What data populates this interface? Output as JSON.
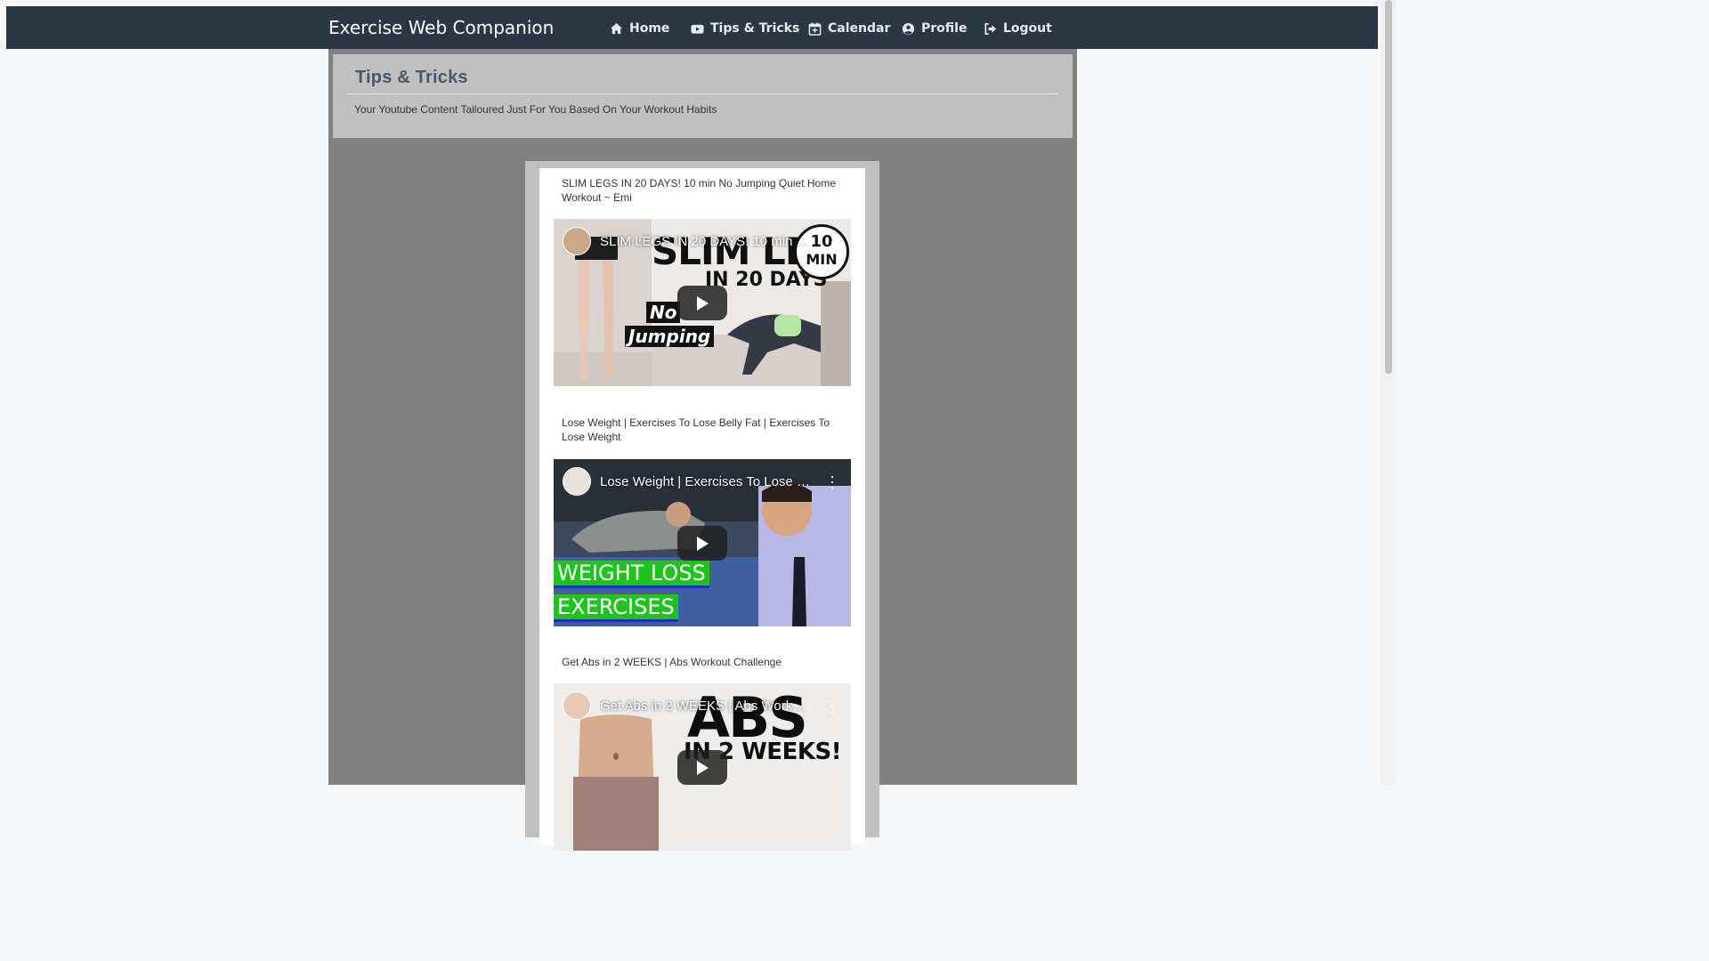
{
  "nav": {
    "brand": "Exercise Web Companion",
    "items": [
      {
        "label": "Home",
        "icon": "home-icon"
      },
      {
        "label": "Tips & Tricks",
        "icon": "youtube-icon"
      },
      {
        "label": "Calendar",
        "icon": "calendar-icon"
      },
      {
        "label": "Profile",
        "icon": "user-circle-icon"
      },
      {
        "label": "Logout",
        "icon": "sign-out-icon"
      }
    ]
  },
  "page": {
    "title": "Tips & Tricks",
    "subtitle": "Your Youtube Content Tailoured Just For You Based On Your Workout Habits"
  },
  "videos": [
    {
      "title": "SLIM LEGS IN 20 DAYS! 10 min No Jumping Quiet Home Workout ~ Emi",
      "player_title": "SLIM LEGS IN 20 DAYS! 10 min N...",
      "thumb_text": [
        "SLIM LEG",
        "IN 20 DAYS",
        "No",
        "Jumping",
        "10",
        "MIN"
      ]
    },
    {
      "title": "Lose Weight | Exercises To Lose Belly Fat | Exercises To Lose Weight",
      "player_title": "Lose Weight | Exercises To Lose B...",
      "thumb_text": [
        "WEIGHT LOSS",
        "EXERCISES"
      ]
    },
    {
      "title": "Get Abs in 2 WEEKS | Abs Workout Challenge",
      "player_title": "Get Abs in 2 WEEKS | Abs Workou...",
      "thumb_text": [
        "ABS",
        "IN 2 WEEKS!"
      ]
    }
  ],
  "colors": {
    "navbar": "#2c3746",
    "container": "#808080",
    "panel": "#c0c0c0",
    "title": "#4a5568",
    "highlight_green": "#1ec31e"
  }
}
